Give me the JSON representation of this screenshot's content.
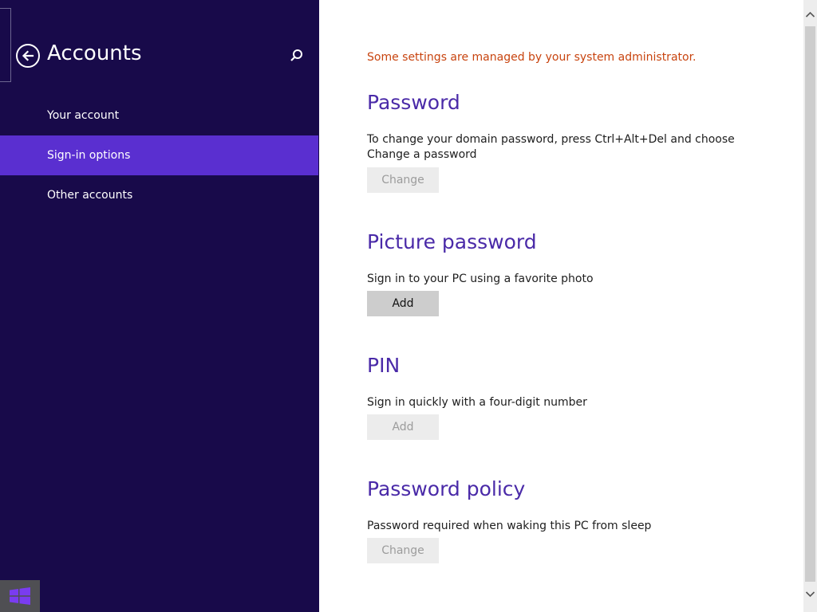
{
  "nav": {
    "title": "Accounts",
    "items": [
      {
        "label": "Your account"
      },
      {
        "label": "Sign-in options"
      },
      {
        "label": "Other accounts"
      }
    ]
  },
  "content": {
    "admin_notice": "Some settings are managed by your system administrator.",
    "sections": [
      {
        "heading": "Password",
        "description": "To change your domain password, press Ctrl+Alt+Del and choose Change a password",
        "button_label": "Change",
        "button_enabled": false
      },
      {
        "heading": "Picture password",
        "description": "Sign in to your PC using a favorite photo",
        "button_label": "Add",
        "button_enabled": true
      },
      {
        "heading": "PIN",
        "description": "Sign in quickly with a four-digit number",
        "button_label": "Add",
        "button_enabled": false
      },
      {
        "heading": "Password policy",
        "description": "Password required when waking this PC from sleep",
        "button_label": "Change",
        "button_enabled": false
      }
    ]
  },
  "icons": {
    "back": "back-arrow-icon",
    "search": "search-icon",
    "start": "windows-logo-icon",
    "scroll_up": "chevron-up-icon",
    "scroll_down": "chevron-down-icon"
  },
  "colors": {
    "nav_background": "#180a4a",
    "nav_selected": "#5a2fd0",
    "heading": "#4a2aa8",
    "notice": "#c8440f"
  }
}
